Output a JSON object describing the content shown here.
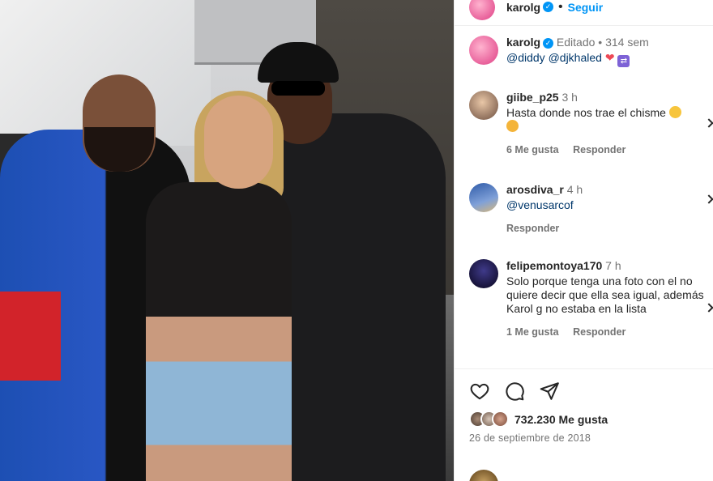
{
  "header": {
    "username": "karolg",
    "follow_label": "Seguir",
    "separator": "•"
  },
  "caption": {
    "username": "karolg",
    "edited": "Editado",
    "separator": "•",
    "time": "314 sem",
    "mention_1": "@diddy",
    "mention_2": "@djkhaled"
  },
  "comments": [
    {
      "username": "giibe_p25",
      "time": "3 h",
      "text": "Hasta donde nos trae el chisme",
      "likes": "6 Me gusta",
      "reply": "Responder"
    },
    {
      "username": "arosdiva_r",
      "time": "4 h",
      "text": "@venusarcof",
      "reply": "Responder"
    },
    {
      "username": "felipemontoya170",
      "time": "7 h",
      "text": "Solo porque tenga una foto con el no quiere decir que ella sea igual, además Karol g no estaba en la lista",
      "likes": "1 Me gusta",
      "reply": "Responder"
    }
  ],
  "post": {
    "likes_count": "732.230 Me gusta",
    "date": "26 de septiembre de 2018"
  },
  "icons": {
    "like": "heart-icon",
    "comment": "comment-icon",
    "share": "share-icon",
    "verified": "verified-badge-icon"
  },
  "colors": {
    "link_blue": "#0095f6",
    "mention": "#00376b",
    "heart": "#ed4956"
  }
}
